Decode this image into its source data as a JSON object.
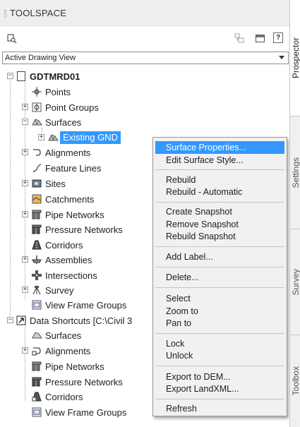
{
  "palette": {
    "title_bar_bg": "#eeeeee",
    "selection": "#3399ff",
    "menu_bg": "#f1f1f1",
    "tab_strip_bg": "#f0f0f0"
  },
  "panel": {
    "title": "TOOLSPACE",
    "toolbar_icons": [
      "scan-icon",
      "item-view-icon",
      "panel-layout-icon",
      "help-icon"
    ],
    "help_glyph": "?",
    "view_dropdown": {
      "selected": "Active Drawing View"
    }
  },
  "tabs": [
    {
      "label": "Prospector",
      "active": true
    },
    {
      "label": "Settings",
      "active": false
    },
    {
      "label": "Survey",
      "active": false
    },
    {
      "label": "Toolbox",
      "active": false
    }
  ],
  "tree": {
    "root": "GDTMRD01",
    "points": "Points",
    "point_groups": "Point Groups",
    "surfaces": "Surfaces",
    "existing_gnd": "Existing GND",
    "alignments": "Alignments",
    "feature_lines": "Feature Lines",
    "sites": "Sites",
    "catchments": "Catchments",
    "pipe_networks": "Pipe Networks",
    "pressure_networks": "Pressure Networks",
    "corridors": "Corridors",
    "assemblies": "Assemblies",
    "intersections": "Intersections",
    "survey": "Survey",
    "view_frame_groups": "View Frame Groups",
    "data_shortcuts": "Data Shortcuts [C:\\Civil 3",
    "ds_surfaces": "Surfaces",
    "ds_alignments": "Alignments",
    "ds_pipe_networks": "Pipe Networks",
    "ds_pressure_networks": "Pressure Networks",
    "ds_corridors": "Corridors",
    "ds_view_frame_groups": "View Frame Groups"
  },
  "context_menu": {
    "surface_properties": "Surface Properties...",
    "edit_surface_style": "Edit Surface Style...",
    "rebuild": "Rebuild",
    "rebuild_automatic": "Rebuild - Automatic",
    "create_snapshot": "Create Snapshot",
    "remove_snapshot": "Remove Snapshot",
    "rebuild_snapshot": "Rebuild Snapshot",
    "add_label": "Add Label...",
    "delete": "Delete...",
    "select": "Select",
    "zoom_to": "Zoom to",
    "pan_to": "Pan to",
    "lock": "Lock",
    "unlock": "Unlock",
    "export_dem": "Export to DEM...",
    "export_landxml": "Export LandXML...",
    "refresh": "Refresh"
  }
}
